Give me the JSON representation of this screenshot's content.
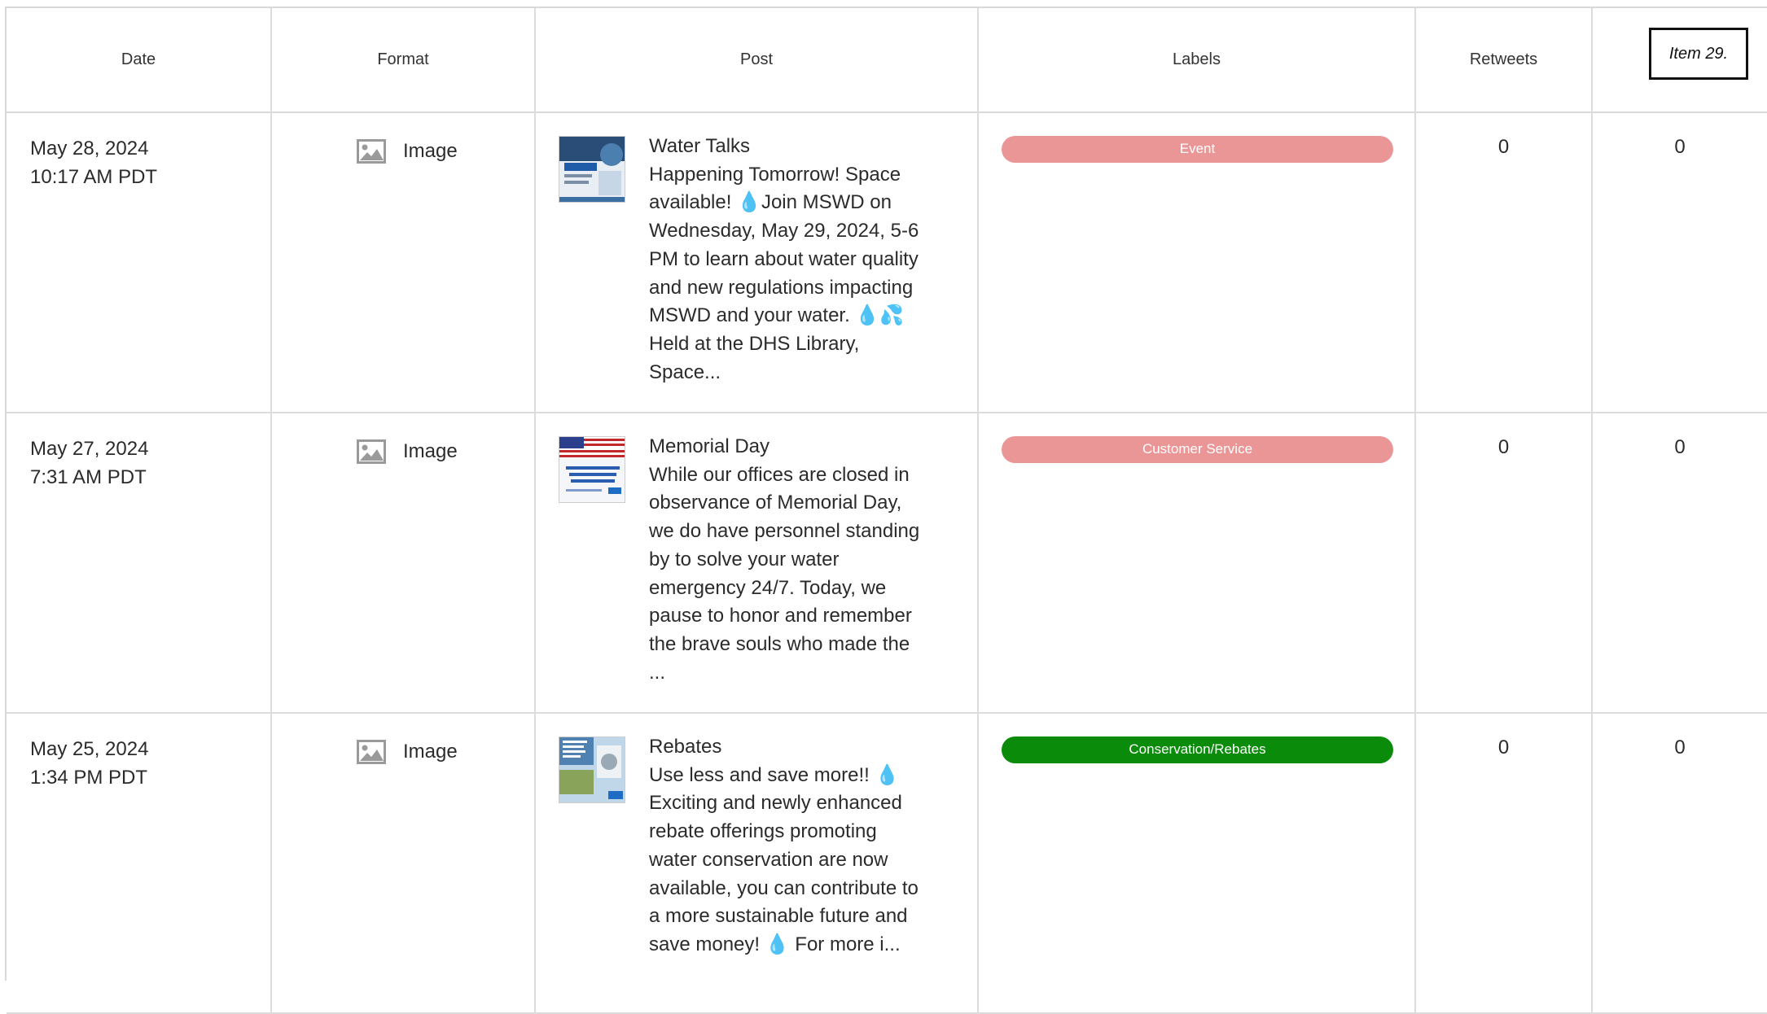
{
  "header": {
    "columns": [
      "Date",
      "Format",
      "Post",
      "Labels",
      "Retweets"
    ],
    "item_label": "Item 29."
  },
  "rows": [
    {
      "date": "May 28, 2024",
      "time": "10:17 AM PDT",
      "format": "Image",
      "post_title": "Water Talks",
      "post_body": "Happening Tomorrow! Space available! 💧Join MSWD on Wednesday, May 29, 2024, 5-6 PM to learn about water quality and new regulations impacting MSWD and your water. 💧💦 Held at the DHS Library, Space...",
      "label": "Event",
      "label_color": "#eb9696",
      "retweets": "0",
      "col6": "0"
    },
    {
      "date": "May 27, 2024",
      "time": "7:31 AM PDT",
      "format": "Image",
      "post_title": "Memorial Day",
      "post_body": "While our offices are closed in observance of Memorial Day, we do have personnel standing by to solve your water emergency 24/7. Today, we pause to honor and remember the brave souls who made the ...",
      "label": "Customer Service",
      "label_color": "#eb9696",
      "retweets": "0",
      "col6": "0"
    },
    {
      "date": "May 25, 2024",
      "time": "1:34 PM PDT",
      "format": "Image",
      "post_title": "Rebates",
      "post_body": "Use less and save more!! 💧 Exciting and newly enhanced rebate offerings promoting water conservation are now available, you can contribute to a more sustainable future and save money! 💧 For more i...",
      "label": "Conservation/Rebates",
      "label_color": "#0a8c0a",
      "retweets": "0",
      "col6": "0"
    }
  ]
}
